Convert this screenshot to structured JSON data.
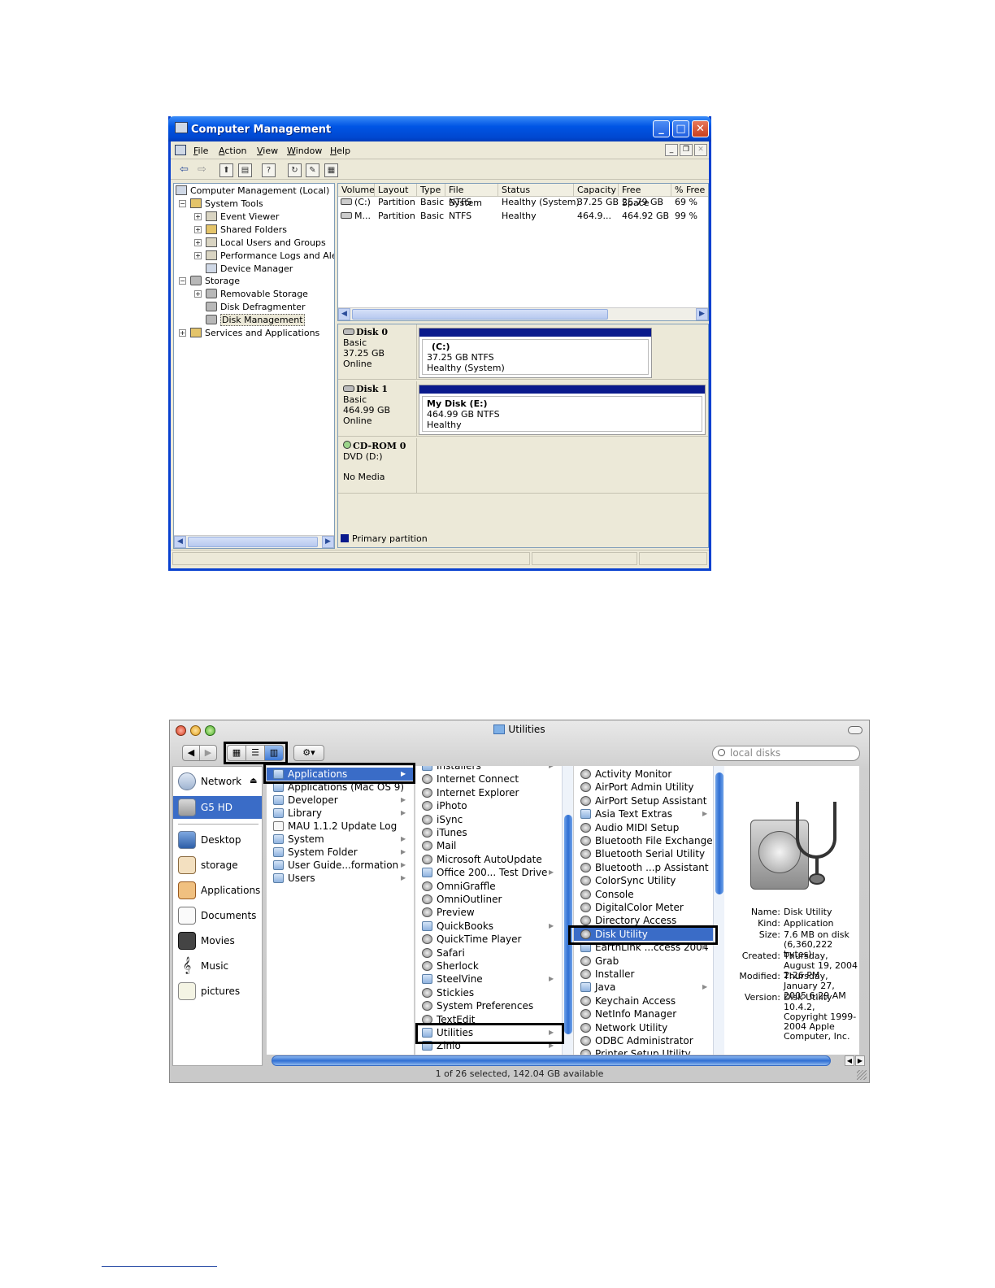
{
  "xp": {
    "title": "Computer Management",
    "menu": [
      {
        "u": "F",
        "rest": "ile"
      },
      {
        "u": "A",
        "rest": "ction"
      },
      {
        "u": "V",
        "rest": "iew"
      },
      {
        "u": "W",
        "rest": "indow"
      },
      {
        "u": "H",
        "rest": "elp"
      }
    ],
    "tree": {
      "root": "Computer Management (Local)",
      "system_tools": "System Tools",
      "event_viewer": "Event Viewer",
      "shared_folders": "Shared Folders",
      "local_users": "Local Users and Groups",
      "perf_logs": "Performance Logs and Alerts",
      "device_manager": "Device Manager",
      "storage": "Storage",
      "removable_storage": "Removable Storage",
      "disk_defrag": "Disk Defragmenter",
      "disk_management": "Disk Management",
      "services_apps": "Services and Applications"
    },
    "columns": [
      "Volume",
      "Layout",
      "Type",
      "File System",
      "Status",
      "Capacity",
      "Free Space",
      "% Free"
    ],
    "rows": [
      [
        "(C:)",
        "Partition",
        "Basic",
        "NTFS",
        "Healthy (System)",
        "37.25 GB",
        "25.79 GB",
        "69 %"
      ],
      [
        "M...",
        "Partition",
        "Basic",
        "NTFS",
        "Healthy",
        "464.9...",
        "464.92 GB",
        "99 %"
      ]
    ],
    "disks": [
      {
        "name": "Disk 0",
        "type": "Basic",
        "size": "37.25 GB",
        "state": "Online",
        "part_name": "(C:)",
        "part_size": "37.25 GB NTFS",
        "part_status": "Healthy (System)"
      },
      {
        "name": "Disk 1",
        "type": "Basic",
        "size": "464.99 GB",
        "state": "Online",
        "part_name": "My Disk  (E:)",
        "part_size": "464.99 GB NTFS",
        "part_status": "Healthy"
      }
    ],
    "cdrom": {
      "name": "CD-ROM 0",
      "drive": "DVD (D:)",
      "media": "No Media"
    },
    "legend": "Primary partition"
  },
  "mac": {
    "title": "Utilities",
    "search_placeholder": "local disks",
    "sidebar": {
      "network": "Network",
      "gshd": "G5 HD",
      "desktop": "Desktop",
      "storage": "storage",
      "applications": "Applications",
      "documents": "Documents",
      "movies": "Movies",
      "music": "Music",
      "pictures": "pictures"
    },
    "col1": [
      "Applications",
      "Applications (Mac OS 9)",
      "Developer",
      "Library",
      "MAU 1.1.2 Update Log",
      "System",
      "System Folder",
      "User Guide...formation",
      "Users"
    ],
    "col2": [
      "Installers",
      "Internet Connect",
      "Internet Explorer",
      "iPhoto",
      "iSync",
      "iTunes",
      "Mail",
      "Microsoft AutoUpdate",
      "Office 200... Test Drive",
      "OmniGraffle",
      "OmniOutliner",
      "Preview",
      "QuickBooks",
      "QuickTime Player",
      "Safari",
      "Sherlock",
      "SteelVine",
      "Stickies",
      "System Preferences",
      "TextEdit",
      "Utilities",
      "Zinio"
    ],
    "col3": [
      "Activity Monitor",
      "AirPort Admin Utility",
      "AirPort Setup Assistant",
      "Asia Text Extras",
      "Audio MIDI Setup",
      "Bluetooth File Exchange",
      "Bluetooth Serial Utility",
      "Bluetooth ...p Assistant",
      "ColorSync Utility",
      "Console",
      "DigitalColor Meter",
      "Directory Access",
      "Disk Utility",
      "EarthLink ...ccess 2004",
      "Grab",
      "Installer",
      "Java",
      "Keychain Access",
      "NetInfo Manager",
      "Network Utility",
      "ODBC Administrator",
      "Printer Setup Utility"
    ],
    "preview": {
      "name_k": "Name:",
      "name_v": "Disk Utility",
      "kind_k": "Kind:",
      "kind_v": "Application",
      "size_k": "Size:",
      "size_v": "7.6 MB on disk (6,360,222 bytes)",
      "created_k": "Created:",
      "created_v": "Thursday, August 19, 2004 2:26 PM",
      "modified_k": "Modified:",
      "modified_v": "Thursday, January 27, 2005 6:29 AM",
      "version_k": "Version:",
      "version_v": "Disk Utility 10.4.2, Copyright 1999-2004 Apple Computer, Inc."
    },
    "status": "1 of 26 selected, 142.04 GB available"
  }
}
